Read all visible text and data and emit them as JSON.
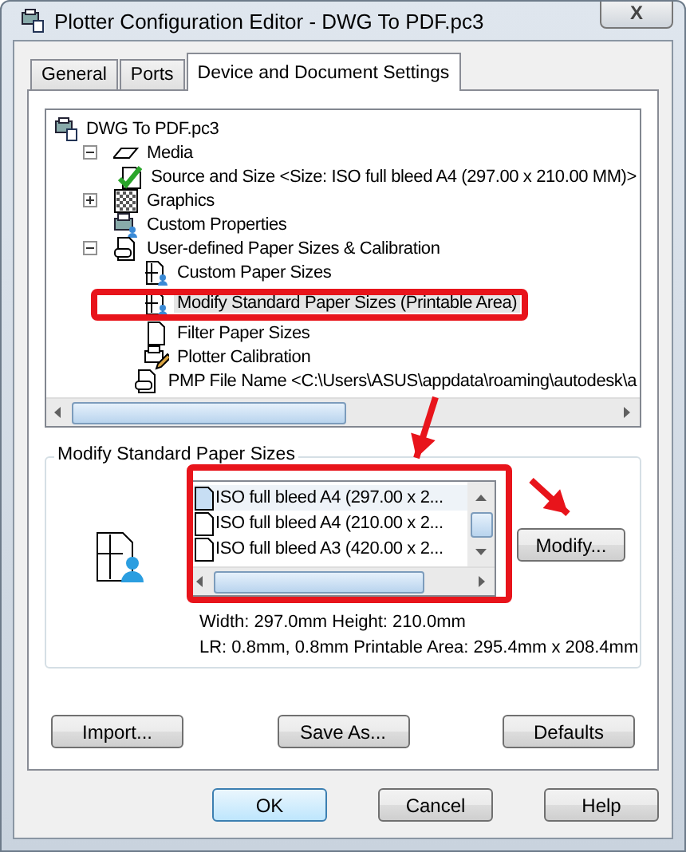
{
  "window": {
    "title": "Plotter Configuration Editor - DWG To PDF.pc3",
    "close": "X"
  },
  "tabs": [
    {
      "label": "General",
      "selected": false
    },
    {
      "label": "Ports",
      "selected": false
    },
    {
      "label": "Device and Document Settings",
      "selected": true
    }
  ],
  "tree": [
    {
      "label": "DWG To PDF.pc3",
      "kind": "printer",
      "selected": false,
      "children": [
        {
          "label": "Media",
          "kind": "media",
          "expanded": true,
          "selected": false,
          "children": [
            {
              "label": "Source and Size <Size: ISO full bleed A4 (297.00 x 210.00 MM)>",
              "kind": "checked-paper",
              "selected": false
            }
          ]
        },
        {
          "label": "Graphics",
          "kind": "graphics",
          "expanded": false,
          "selected": false
        },
        {
          "label": "Custom Properties",
          "kind": "properties",
          "selected": false
        },
        {
          "label": "User-defined Paper Sizes & Calibration",
          "kind": "paper",
          "expanded": true,
          "selected": false,
          "children": [
            {
              "label": "Custom Paper Sizes",
              "kind": "paper-size",
              "selected": false
            },
            {
              "label": "Modify Standard Paper Sizes (Printable Area)",
              "kind": "paper-size",
              "selected": true
            },
            {
              "label": "Filter Paper Sizes",
              "kind": "blank-paper",
              "selected": false
            },
            {
              "label": "Plotter Calibration",
              "kind": "calibration",
              "selected": false
            },
            {
              "label": "PMP File Name <C:\\Users\\ASUS\\appdata\\roaming\\autodesk\\a",
              "kind": "paper",
              "selected": false
            }
          ]
        }
      ]
    }
  ],
  "group": {
    "title": "Modify Standard Paper Sizes",
    "sizes": [
      {
        "label": "ISO full bleed A4 (297.00 x 2...",
        "selected": true
      },
      {
        "label": "ISO full bleed A4 (210.00 x 2...",
        "selected": false
      },
      {
        "label": "ISO full bleed A3 (420.00 x 2...",
        "selected": false
      }
    ],
    "modify_button": "Modify...",
    "dimensions": "Width: 297.0mm Height: 210.0mm",
    "margins": "LR: 0.8mm, 0.8mm  Printable Area: 295.4mm x 208.4mm"
  },
  "tab_buttons": [
    "Import...",
    "Save As...",
    "Defaults"
  ],
  "dialog_buttons": [
    {
      "label": "OK",
      "default": true
    },
    {
      "label": "Cancel",
      "default": false
    },
    {
      "label": "Help",
      "default": false
    }
  ]
}
